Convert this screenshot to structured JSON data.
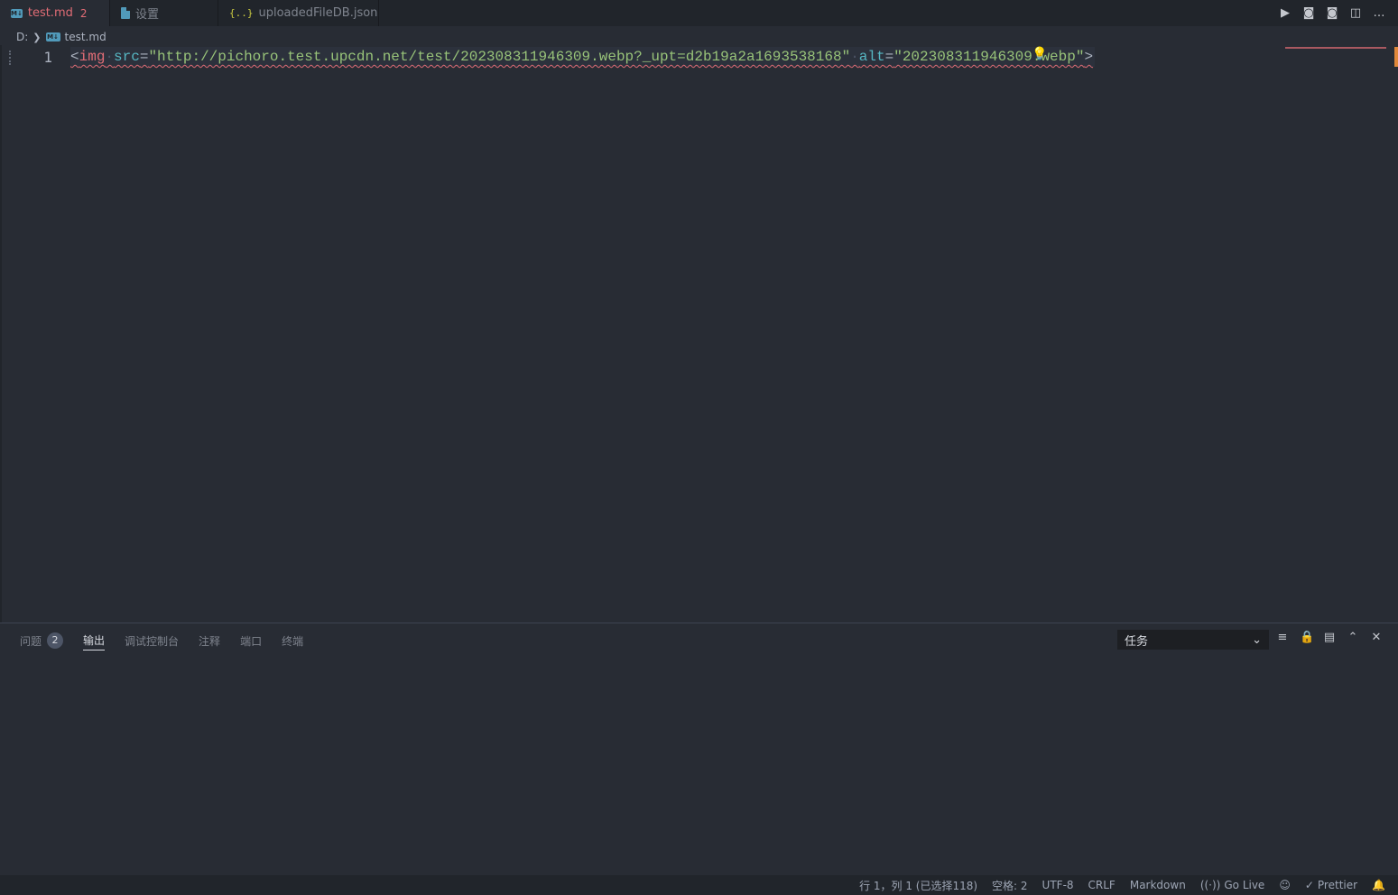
{
  "tabs": [
    {
      "label": "test.md",
      "problems": "2",
      "dirty": true
    },
    {
      "label": "设置"
    },
    {
      "label": "uploadedFileDB.json"
    }
  ],
  "tab_icons": {
    "markdown": "M↓",
    "json": "{..}"
  },
  "tab_actions": [
    {
      "name": "run-icon",
      "glyph": "▶"
    },
    {
      "name": "preview-icon",
      "glyph": "◙"
    },
    {
      "name": "preview-side-icon",
      "glyph": "◙"
    },
    {
      "name": "split-editor-icon",
      "glyph": "◫"
    },
    {
      "name": "more-actions-icon",
      "glyph": "…"
    }
  ],
  "breadcrumb": {
    "drive": "D:",
    "sep": "❯",
    "file": "test.md"
  },
  "editor": {
    "line_number": "1",
    "tokens": {
      "open": "<",
      "tag": "img",
      "ws1": "·",
      "attr1": "src",
      "eq1": "=",
      "val1": "\"http://pichoro.test.upcdn.net/test/202308311946309.webp?_upt=d2b19a2a1693538168\"",
      "ws2": "·",
      "attr2": "alt",
      "eq2": "=",
      "val2": "\"202308311946309.webp\"",
      "close": ">"
    },
    "lightbulb": "💡"
  },
  "panel": {
    "tabs": [
      {
        "label": "问题",
        "badge": "2"
      },
      {
        "label": "输出"
      },
      {
        "label": "调试控制台"
      },
      {
        "label": "注释"
      },
      {
        "label": "端口"
      },
      {
        "label": "终端"
      }
    ],
    "active_tab": "输出",
    "select_value": "任务",
    "actions": [
      {
        "name": "clear-output-icon",
        "glyph": "≡"
      },
      {
        "name": "lock-icon",
        "glyph": "🔒"
      },
      {
        "name": "open-log-icon",
        "glyph": "▤"
      },
      {
        "name": "maximize-panel-icon",
        "glyph": "⌃"
      },
      {
        "name": "close-panel-icon",
        "glyph": "✕"
      }
    ]
  },
  "statusbar": {
    "position": "行 1，列 1 (已选择118)",
    "spaces": "空格: 2",
    "encoding": "UTF-8",
    "eol": "CRLF",
    "language": "Markdown",
    "golive": "Go Live",
    "prettier": "Prettier"
  },
  "colors": {
    "background": "#282c34",
    "tabbar": "#21252b",
    "tag": "#e06c75",
    "attribute": "#56b6c2",
    "string": "#98c379"
  }
}
